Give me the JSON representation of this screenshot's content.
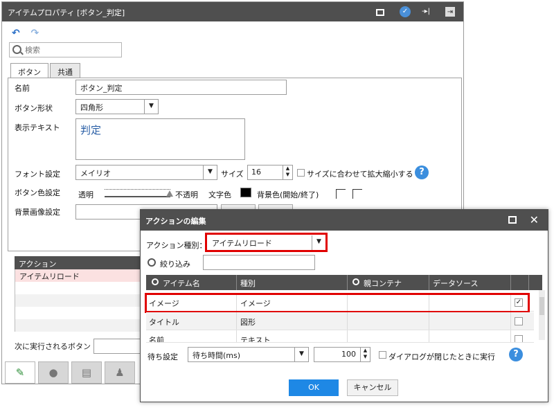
{
  "main": {
    "title": "アイテムプロパティ [ボタン_判定]",
    "search_placeholder": "検索",
    "tabs": [
      "ボタン",
      "共通"
    ],
    "labels": {
      "name": "名前",
      "shape": "ボタン形状",
      "text": "表示テキスト",
      "font": "フォント設定",
      "size": "サイズ",
      "fit": "サイズに合わせて拡大縮小する",
      "color": "ボタン色設定",
      "transparent": "透明",
      "opaque": "不透明",
      "text_color": "文字色",
      "bg_color": "背景色(開始/終了)",
      "bg_image": "背景画像設定"
    },
    "values": {
      "name": "ボタン_判定",
      "shape": "四角形",
      "text": "判定",
      "font": "メイリオ",
      "size": "16"
    },
    "colors": {
      "text_color": "#000000"
    },
    "actions_header": "アクション",
    "actions": [
      "アイテムリロード"
    ],
    "next_button_label": "次に実行されるボタン"
  },
  "dialog": {
    "title": "アクションの編集",
    "action_type_label": "アクション種別：",
    "action_type_value": "アイテムリロード",
    "filter_label": "絞り込み",
    "columns": [
      "アイテム名",
      "種別",
      "親コンテナ",
      "データソース"
    ],
    "rows": [
      {
        "name": "イメージ",
        "type": "イメージ",
        "parent": "",
        "source": "",
        "checked": true
      },
      {
        "name": "タイトル",
        "type": "図形",
        "parent": "",
        "source": "",
        "checked": false
      },
      {
        "name": "名前",
        "type": "テキスト",
        "parent": "",
        "source": "",
        "checked": false
      }
    ],
    "wait_label": "待ち設定",
    "wait_value": "待ち時間(ms)",
    "wait_ms": "100",
    "close_exec_label": "ダイアログが閉じたときに実行",
    "ok": "OK",
    "cancel": "キャンセル"
  },
  "colors": {
    "accent": "#1e88e5",
    "highlight": "#e00000",
    "titlebar": "#4f4f4f"
  }
}
